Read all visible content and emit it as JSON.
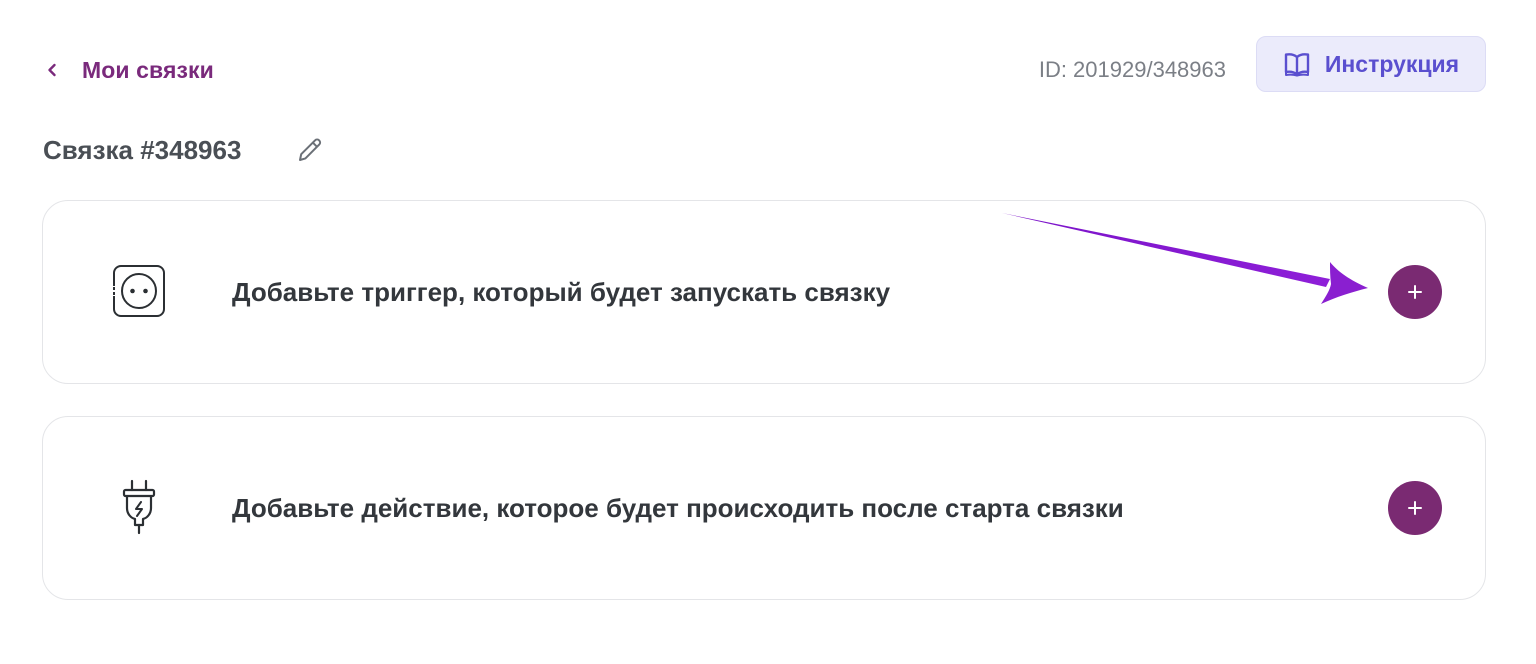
{
  "header": {
    "back_label": "Мои связки",
    "id_text": "ID: 201929/348963",
    "instructions_label": "Инструкция"
  },
  "title": {
    "text": "Связка #348963"
  },
  "trigger_card": {
    "icon": "socket-icon",
    "text": "Добавьте триггер, который будет запускать связку",
    "add_icon": "plus-icon"
  },
  "action_card": {
    "icon": "plug-icon",
    "text": "Добавьте действие, которое будет происходить после старта связки",
    "add_icon": "plus-icon"
  },
  "colors": {
    "brand": "#7a2a72",
    "back_link": "#7a2a7c",
    "instructions_bg": "#ebebfb",
    "instructions_text": "#5a4fcf",
    "annotation_arrow": "#8a1fd0"
  }
}
